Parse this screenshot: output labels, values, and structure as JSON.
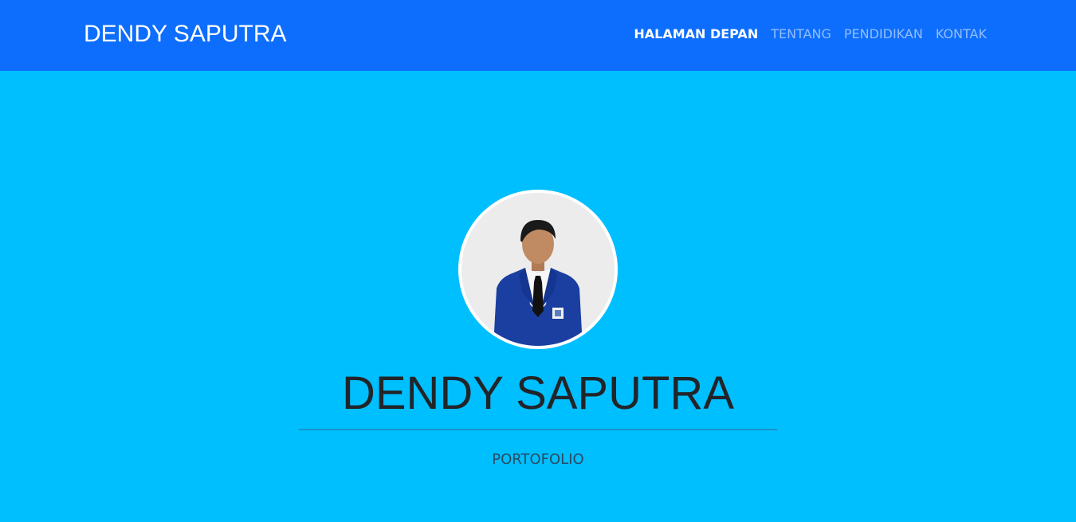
{
  "navbar": {
    "brand": "DENDY SAPUTRA",
    "items": [
      {
        "label": "HALAMAN DEPAN",
        "active": true
      },
      {
        "label": "TENTANG",
        "active": false
      },
      {
        "label": "PENDIDIKAN",
        "active": false
      },
      {
        "label": "KONTAK",
        "active": false
      }
    ]
  },
  "hero": {
    "title": "DENDY SAPUTRA",
    "subtitle": "PORTOFOLIO",
    "avatar_icon": "profile-photo"
  },
  "colors": {
    "navbar_bg": "#0d6efd",
    "hero_bg": "#00bfff",
    "title_text": "#212529"
  }
}
